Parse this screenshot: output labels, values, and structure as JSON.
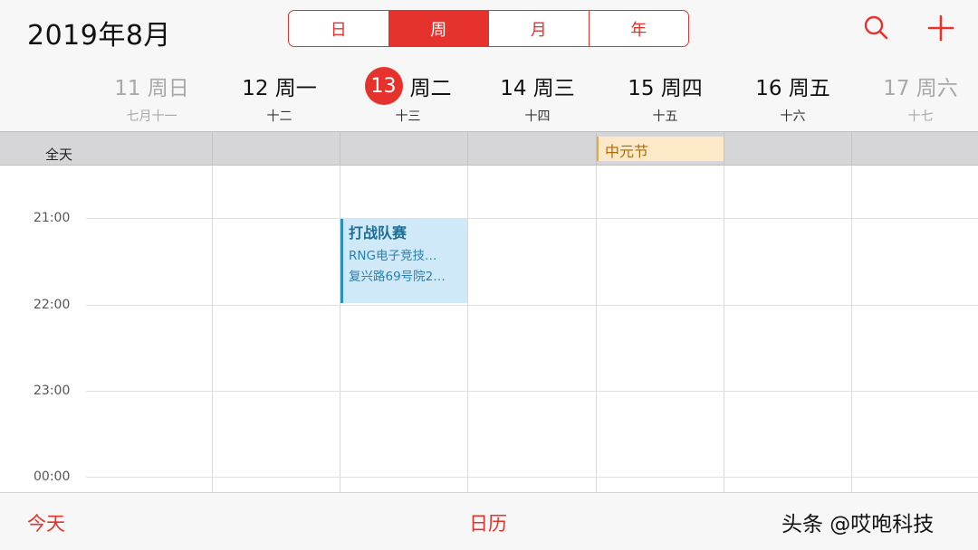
{
  "header": {
    "title": "2019年8月",
    "segments": [
      "日",
      "周",
      "月",
      "年"
    ],
    "active_segment": "周"
  },
  "days": [
    {
      "main": "11 周日",
      "lunar": "七月十一"
    },
    {
      "main": "12 周一",
      "lunar": "十二"
    },
    {
      "date": "13",
      "weekday": "周二",
      "lunar": "十三"
    },
    {
      "main": "14 周三",
      "lunar": "十四"
    },
    {
      "main": "15 周四",
      "lunar": "十五"
    },
    {
      "main": "16 周五",
      "lunar": "十六"
    },
    {
      "main": "17 周六",
      "lunar": "十七"
    }
  ],
  "allday": {
    "label": "全天",
    "event": "中元节"
  },
  "times": [
    "21:00",
    "22:00",
    "23:00",
    "00:00"
  ],
  "event": {
    "title": "打战队赛",
    "line1": "RNG电子竞技…",
    "line2": "复兴路69号院2…"
  },
  "bottom": {
    "today": "今天",
    "calendar": "日历",
    "watermark": "头条 @哎咆科技"
  },
  "colors": {
    "accent": "#e5322d",
    "event_bg": "#cfe9f9",
    "allday_event_bg": "#fde9c7"
  },
  "icons": {
    "search": "search-icon",
    "add": "plus-icon"
  }
}
